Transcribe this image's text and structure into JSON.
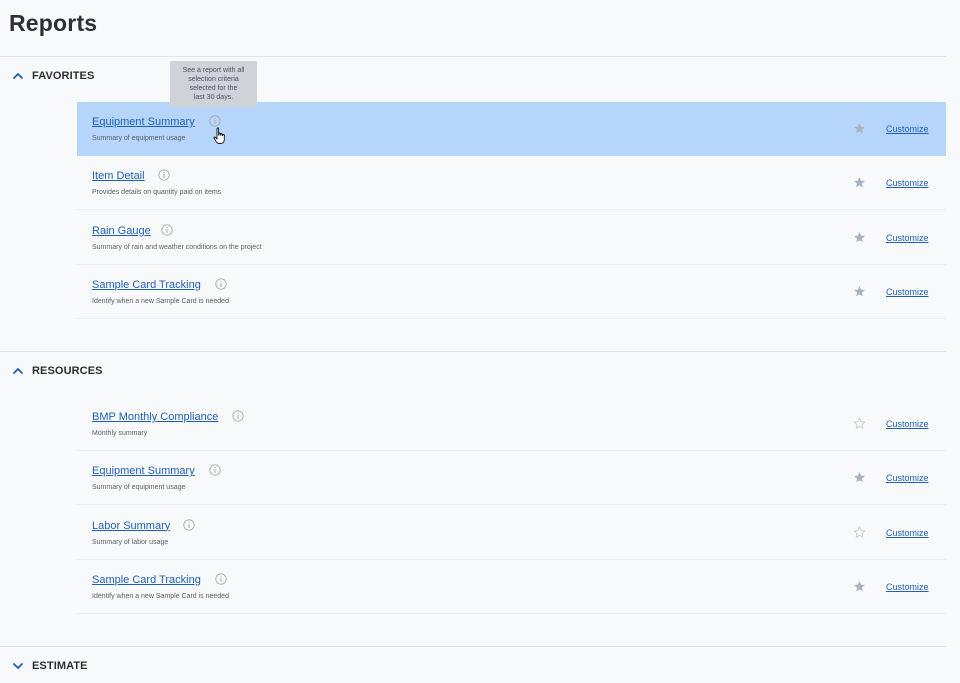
{
  "page": {
    "title": "Reports"
  },
  "tooltip": {
    "lines": [
      "See a report with all",
      "selection criteria",
      "selected for the",
      "last 30 days."
    ]
  },
  "sections": {
    "favorites": {
      "label": "FAVORITES",
      "expanded": true,
      "reports": [
        {
          "name": "Equipment Summary",
          "description": "Summary of equipment usage",
          "favorite": true,
          "action": "Customize",
          "highlighted": true
        },
        {
          "name": "Item Detail",
          "description": "Provides details on quantity paid on items",
          "favorite": true,
          "action": "Customize"
        },
        {
          "name": "Rain Gauge",
          "description": "Summary of rain and weather conditions on the project",
          "favorite": true,
          "action": "Customize"
        },
        {
          "name": "Sample Card Tracking",
          "description": "Identify when a new Sample Card is needed",
          "favorite": true,
          "action": "Customize"
        }
      ]
    },
    "resources": {
      "label": "RESOURCES",
      "expanded": true,
      "reports": [
        {
          "name": "BMP Monthly Compliance",
          "description": "Monthly summary",
          "favorite": false,
          "action": "Customize"
        },
        {
          "name": "Equipment Summary",
          "description": "Summary of equipment usage",
          "favorite": true,
          "action": "Customize"
        },
        {
          "name": "Labor Summary",
          "description": "Summary of labor usage",
          "favorite": false,
          "action": "Customize"
        },
        {
          "name": "Sample Card Tracking",
          "description": "Identify when a new Sample Card is needed",
          "favorite": true,
          "action": "Customize"
        }
      ]
    },
    "estimate": {
      "label": "ESTIMATE",
      "expanded": false
    }
  },
  "icons": {
    "section_expanded": "chevron-up-icon",
    "section_collapsed": "chevron-down-icon",
    "info": "info-icon",
    "favorite": "star-filled-icon",
    "not_favorite": "star-outline-icon",
    "cursor": "hand-pointer-icon"
  },
  "colors": {
    "link": "#1f5fb8",
    "highlight": "#b5d6fa",
    "chevron": "#1f5fb8",
    "star_filled": "#aab4c0",
    "star_outline": "#c5cbd3",
    "tooltip_bg": "#cfd3d8"
  }
}
